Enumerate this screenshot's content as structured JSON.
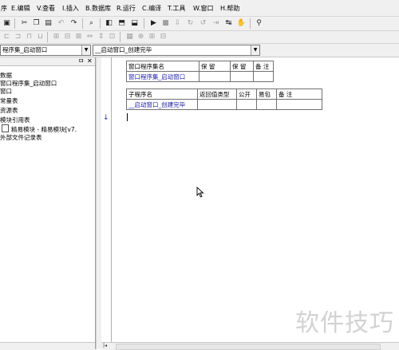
{
  "menubar": {
    "items": [
      "序",
      "E.编辑",
      "V.查看",
      "I.插入",
      "B.数据库",
      "R.运行",
      "C.编译",
      "T.工具",
      "W.窗口",
      "H.帮助"
    ]
  },
  "toolbar1": {
    "icons": [
      "save-icon",
      "cut-icon",
      "copy-icon",
      "paste-icon",
      "undo-icon",
      "redo-icon",
      "find-icon",
      "layout-icon",
      "run-icon",
      "stop-icon",
      "step-icon",
      "binoculars-icon"
    ]
  },
  "combos": {
    "left_value": "程序集_启动窗口",
    "right_value": "__启动窗口_创建完毕"
  },
  "panel": {
    "pin": "ㅁ",
    "close": "✕",
    "tree": [
      "数据",
      "窗口程序集_启动窗口",
      "窗口",
      "常量表",
      "资源表",
      "模块引用表",
      "精易模块 - 精易模块[v7.",
      "外部文件记录表"
    ]
  },
  "editor": {
    "gutter_arrow": "↓",
    "assembly_table": {
      "headers": [
        "窗口程序集名",
        "保 留",
        "保 留",
        "备 注"
      ],
      "row": [
        "窗口程序集_启动窗口",
        "",
        "",
        ""
      ]
    },
    "sub_table": {
      "headers": [
        "子程序名",
        "返回值类型",
        "公开",
        "易包",
        "备 注"
      ],
      "row": [
        "__启动窗口_创建完毕",
        "",
        "",
        "",
        ""
      ]
    }
  },
  "watermark": "软件技巧"
}
